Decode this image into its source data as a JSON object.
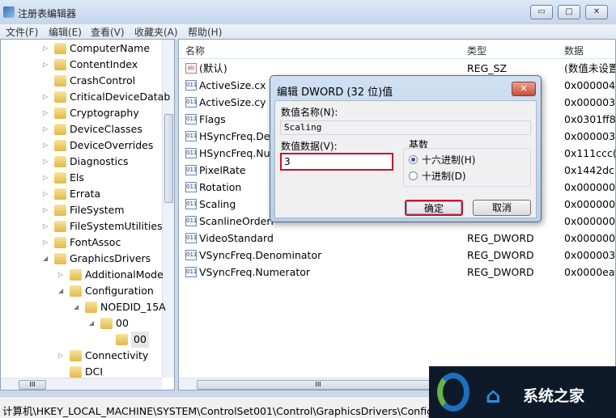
{
  "window": {
    "title": "注册表编辑器",
    "minimize": "▭",
    "maximize": "□",
    "close": "✕"
  },
  "menu": [
    "文件(F)",
    "编辑(E)",
    "查看(V)",
    "收藏夹(A)",
    "帮助(H)"
  ],
  "tree": [
    {
      "label": "ComputerName",
      "level": 0,
      "expander": "collapsed"
    },
    {
      "label": "ContentIndex",
      "level": 0,
      "expander": "collapsed"
    },
    {
      "label": "CrashControl",
      "level": 0,
      "expander": "none"
    },
    {
      "label": "CriticalDeviceDatab",
      "level": 0,
      "expander": "collapsed"
    },
    {
      "label": "Cryptography",
      "level": 0,
      "expander": "collapsed"
    },
    {
      "label": "DeviceClasses",
      "level": 0,
      "expander": "collapsed"
    },
    {
      "label": "DeviceOverrides",
      "level": 0,
      "expander": "collapsed"
    },
    {
      "label": "Diagnostics",
      "level": 0,
      "expander": "collapsed"
    },
    {
      "label": "Els",
      "level": 0,
      "expander": "collapsed"
    },
    {
      "label": "Errata",
      "level": 0,
      "expander": "collapsed"
    },
    {
      "label": "FileSystem",
      "level": 0,
      "expander": "collapsed"
    },
    {
      "label": "FileSystemUtilities",
      "level": 0,
      "expander": "collapsed"
    },
    {
      "label": "FontAssoc",
      "level": 0,
      "expander": "collapsed"
    },
    {
      "label": "GraphicsDrivers",
      "level": 0,
      "expander": "expanded"
    },
    {
      "label": "AdditionalMode",
      "level": 1,
      "expander": "collapsed"
    },
    {
      "label": "Configuration",
      "level": 1,
      "expander": "expanded"
    },
    {
      "label": "NOEDID_15A",
      "level": 2,
      "expander": "expanded"
    },
    {
      "label": "00",
      "level": 3,
      "expander": "expanded"
    },
    {
      "label": "00",
      "level": 4,
      "expander": "none",
      "selected": true
    },
    {
      "label": "Connectivity",
      "level": 1,
      "expander": "collapsed"
    },
    {
      "label": "DCI",
      "level": 1,
      "expander": "none"
    }
  ],
  "list": {
    "headers": {
      "name": "名称",
      "type": "类型",
      "data": "数据"
    },
    "rows": [
      {
        "icon": "string-value-icon",
        "name": "(默认)",
        "type": "REG_SZ",
        "data": "(数值未设置)"
      },
      {
        "icon": "dword-value-icon",
        "name": "ActiveSize.cx",
        "type": "",
        "data": "0x000004"
      },
      {
        "icon": "dword-value-icon",
        "name": "ActiveSize.cy",
        "type": "",
        "data": "0x000003"
      },
      {
        "icon": "dword-value-icon",
        "name": "Flags",
        "type": "",
        "data": "0x0301ff8"
      },
      {
        "icon": "dword-value-icon",
        "name": "HSyncFreq.Den",
        "type": "",
        "data": "0x000003"
      },
      {
        "icon": "dword-value-icon",
        "name": "HSyncFreq.Nu",
        "type": "",
        "data": "0x111ccc("
      },
      {
        "icon": "dword-value-icon",
        "name": "PixelRate",
        "type": "",
        "data": "0x1442dc"
      },
      {
        "icon": "dword-value-icon",
        "name": "Rotation",
        "type": "",
        "data": "0x000000"
      },
      {
        "icon": "dword-value-icon",
        "name": "Scaling",
        "type": "",
        "data": "0x000000"
      },
      {
        "icon": "dword-value-icon",
        "name": "ScanlineOrderi",
        "type": "",
        "data": "0x000000"
      },
      {
        "icon": "dword-value-icon",
        "name": "VideoStandard",
        "type": "REG_DWORD",
        "data": "0x000000"
      },
      {
        "icon": "dword-value-icon",
        "name": "VSyncFreq.Denominator",
        "type": "REG_DWORD",
        "data": "0x000003"
      },
      {
        "icon": "dword-value-icon",
        "name": "VSyncFreq.Numerator",
        "type": "REG_DWORD",
        "data": "0x0000ea"
      }
    ]
  },
  "dialog": {
    "title": "编辑 DWORD (32 位)值",
    "close": "✕",
    "name_label": "数值名称(N):",
    "name_value": "Scaling",
    "data_label": "数值数据(V):",
    "data_value": "3",
    "base_label": "基数",
    "hex_label": "十六进制(H)",
    "dec_label": "十进制(D)",
    "base_selected": "hex",
    "ok": "确定",
    "cancel": "取消",
    "highlight_color": "#c8102e"
  },
  "status": "计算机\\HKEY_LOCAL_MACHINE\\SYSTEM\\ControlSet001\\Control\\GraphicsDrivers\\Configurat",
  "watermark": {
    "text": "系统之家"
  }
}
